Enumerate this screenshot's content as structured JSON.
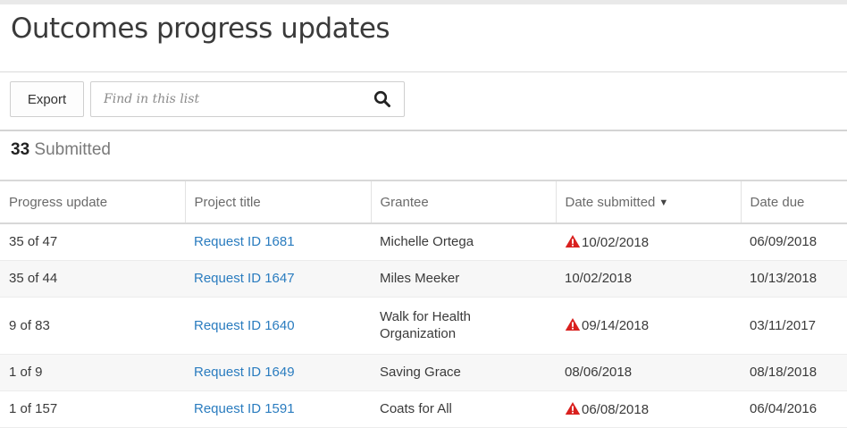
{
  "page": {
    "title": "Outcomes progress updates"
  },
  "toolbar": {
    "export_label": "Export",
    "search_placeholder": "Find in this list",
    "search_value": ""
  },
  "summary": {
    "count": "33",
    "label": "Submitted"
  },
  "table": {
    "columns": [
      {
        "label": "Progress update"
      },
      {
        "label": "Project title"
      },
      {
        "label": "Grantee"
      },
      {
        "label": "Date submitted",
        "sorted": "desc"
      },
      {
        "label": "Date due"
      }
    ],
    "rows": [
      {
        "progress": "35 of 47",
        "project": "Request ID 1681",
        "grantee": "Michelle Ortega",
        "submitted": "10/02/2018",
        "warning": true,
        "due": "06/09/2018"
      },
      {
        "progress": "35 of 44",
        "project": "Request ID 1647",
        "grantee": "Miles Meeker",
        "submitted": "10/02/2018",
        "warning": false,
        "due": "10/13/2018"
      },
      {
        "progress": "9 of 83",
        "project": "Request ID 1640",
        "grantee": "Walk for Health Organization",
        "submitted": "09/14/2018",
        "warning": true,
        "due": "03/11/2017"
      },
      {
        "progress": "1 of 9",
        "project": "Request ID 1649",
        "grantee": "Saving Grace",
        "submitted": "08/06/2018",
        "warning": false,
        "due": "08/18/2018"
      },
      {
        "progress": "1 of 157",
        "project": "Request ID 1591",
        "grantee": "Coats for All",
        "submitted": "06/08/2018",
        "warning": true,
        "due": "06/04/2016"
      }
    ]
  },
  "icons": {
    "search": "search-icon",
    "warning": "warning-triangle-icon",
    "sort": "sort-caret-down-icon"
  },
  "colors": {
    "link": "#2a7cbf",
    "warning": "#d9201e"
  }
}
